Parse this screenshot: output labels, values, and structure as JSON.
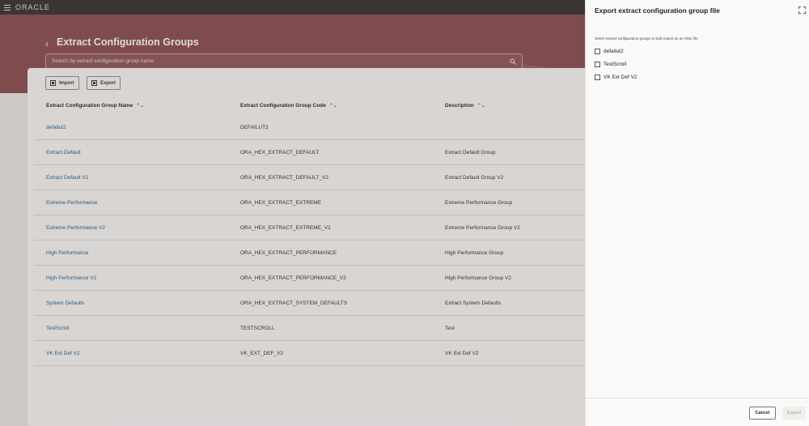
{
  "brand": {
    "name": "ORACLE"
  },
  "header": {
    "title": "Extract Configuration Groups",
    "search_placeholder": "Search by extract configuration group name"
  },
  "toolbar": {
    "import_label": "Import",
    "export_label": "Export"
  },
  "table": {
    "columns": [
      "Extract Configuration Group Name",
      "Extract Configuration Group Code",
      "Description"
    ],
    "rows": [
      {
        "name": "defailut2",
        "code": "DEFAILUT2",
        "description": ""
      },
      {
        "name": "Extract Default",
        "code": "ORA_HEX_EXTRACT_DEFAULT",
        "description": "Extract Default Group"
      },
      {
        "name": "Extract Default V2",
        "code": "ORA_HEX_EXTRACT_DEFAULT_V2",
        "description": "Extract Default Group V2"
      },
      {
        "name": "Extreme Performance",
        "code": "ORA_HEX_EXTRACT_EXTREME",
        "description": "Extreme Performance Group"
      },
      {
        "name": "Extreme Performance V2",
        "code": "ORA_HEX_EXTRACT_EXTREME_V2",
        "description": "Extreme Performance Group V2"
      },
      {
        "name": "High Performance",
        "code": "ORA_HEX_EXTRACT_PERFORMANCE",
        "description": "High Performance Group"
      },
      {
        "name": "High Performance V2",
        "code": "ORA_HEX_EXTRACT_PERFORMANCE_V2",
        "description": "High Performance Group V2"
      },
      {
        "name": "System Defaults",
        "code": "ORA_HEX_EXTRACT_SYSTEM_DEFAULTS",
        "description": "Extract System Defaults"
      },
      {
        "name": "TestScroll",
        "code": "TESTSCROLL",
        "description": "Test"
      },
      {
        "name": "VK Ext Def V2",
        "code": "VK_EXT_DEF_V2",
        "description": "VK Ext Def V2"
      }
    ]
  },
  "drawer": {
    "title": "Export extract configuration group file",
    "description": "Select extract configuration groups to bulk export as an XML file.",
    "options": [
      {
        "label": "defailut2",
        "checked": false
      },
      {
        "label": "TestScroll",
        "checked": false
      },
      {
        "label": "VK Ext Def V2",
        "checked": false
      }
    ],
    "cancel_label": "Cancel",
    "export_label": "Export"
  },
  "colors": {
    "header_band": "#8a4a4e",
    "top_bar": "#312d2a",
    "link": "#1c5a8f"
  }
}
